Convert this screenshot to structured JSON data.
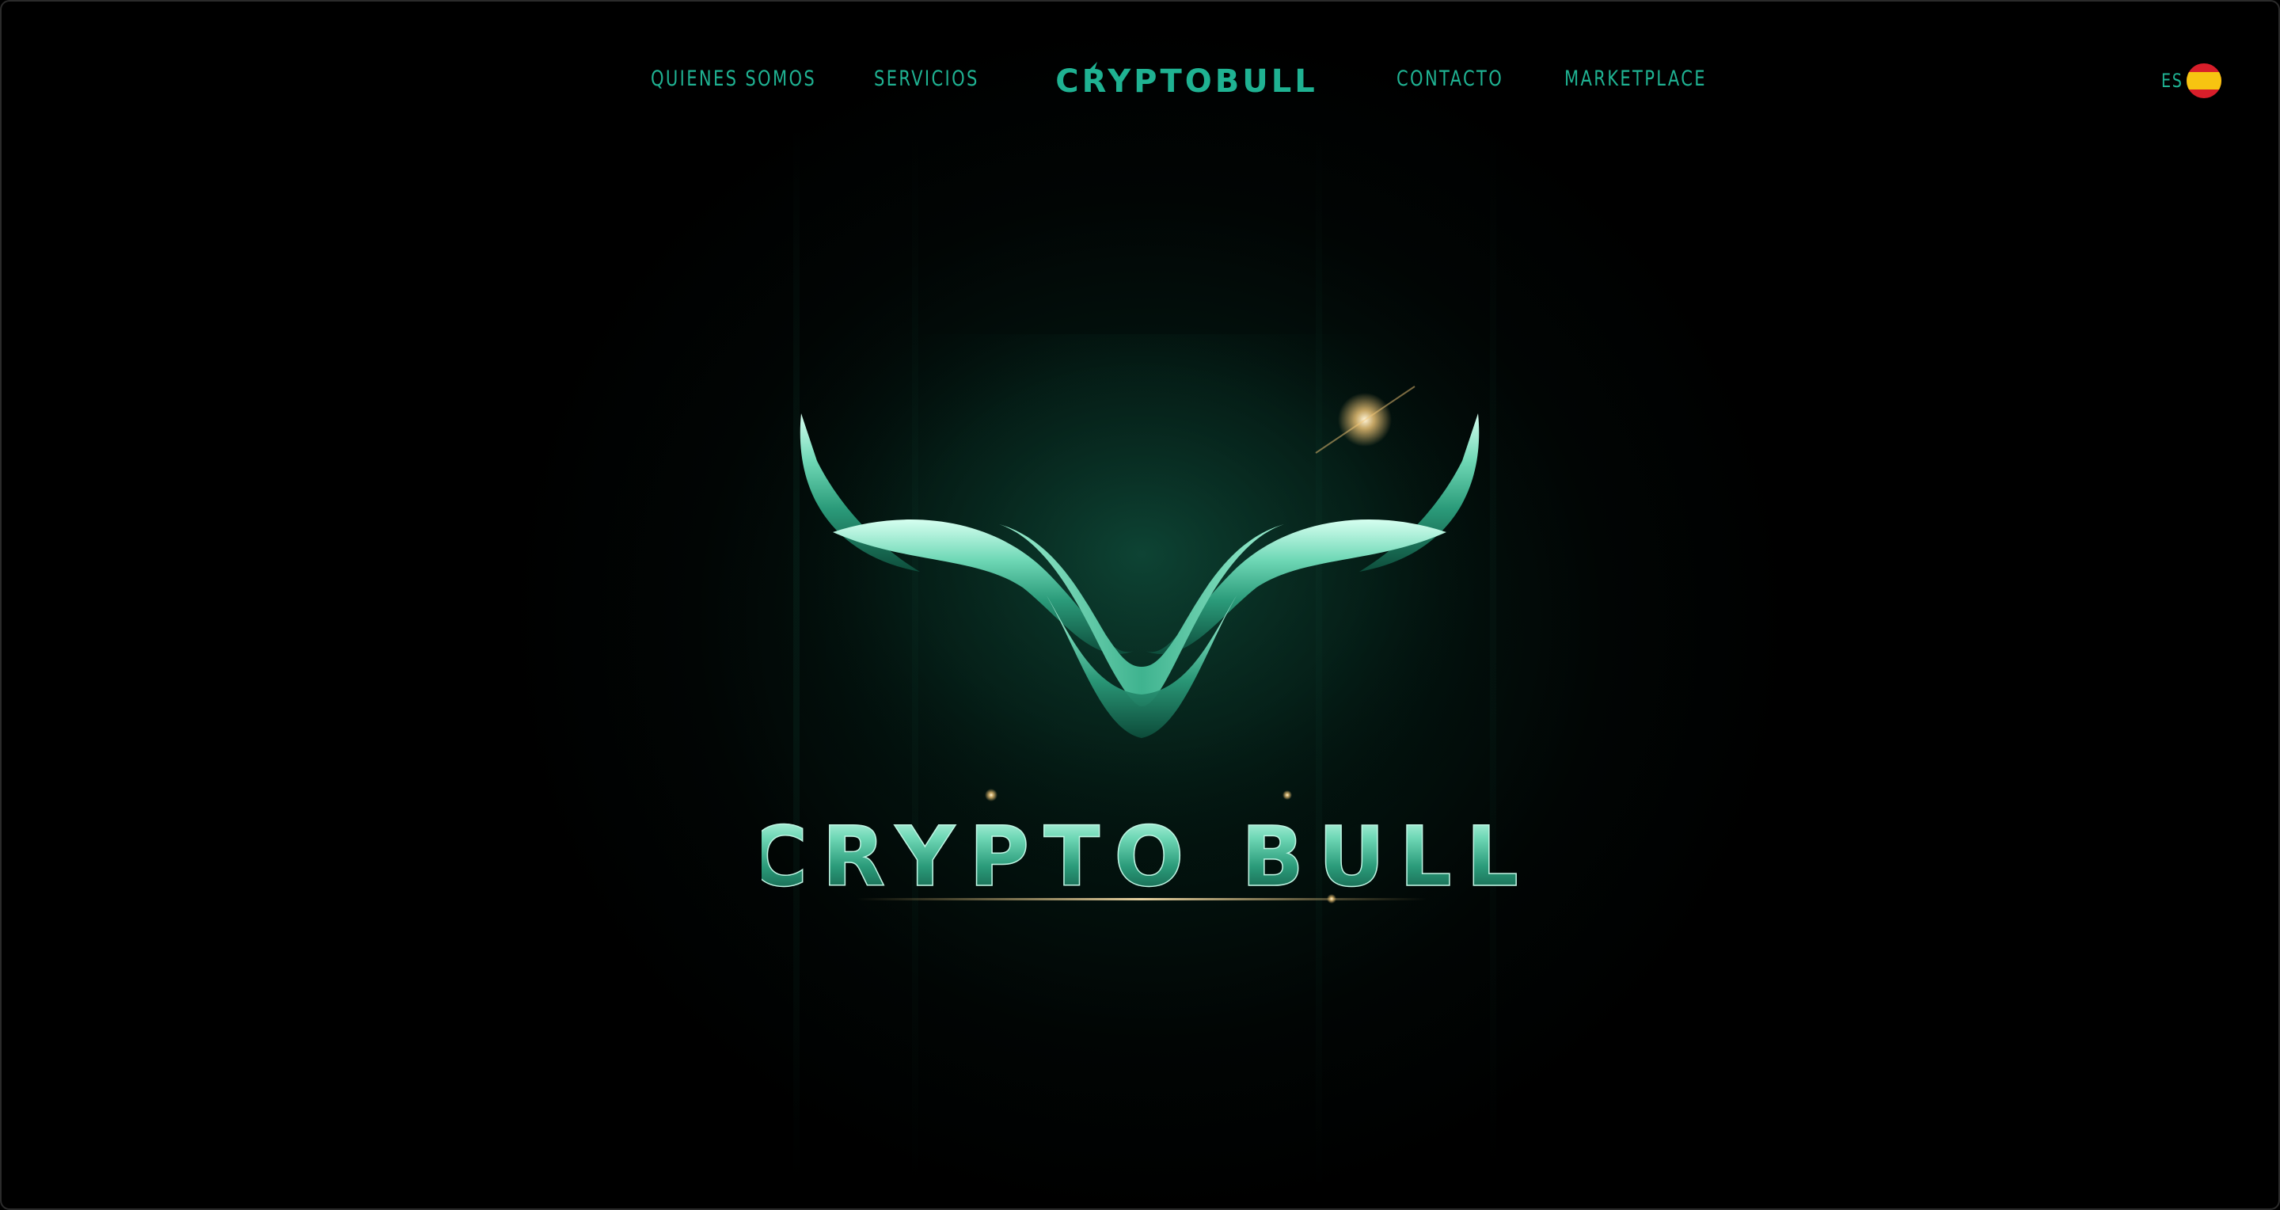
{
  "brand": {
    "logo_text": "CRYPTOBULL",
    "hero_logo_text": "CRYPTO BULL"
  },
  "nav": {
    "items": [
      {
        "label": "QUIENES SOMOS"
      },
      {
        "label": "SERVICIOS"
      },
      {
        "label": "CONTACTO"
      },
      {
        "label": "MARKETPLACE"
      }
    ]
  },
  "language": {
    "code": "ES",
    "flag_icon": "spain-flag-icon"
  },
  "colors": {
    "accent": "#1fb292",
    "background": "#000000",
    "glow": "#0b3b2d",
    "chrome_light": "#bff5e3",
    "chrome_mid": "#4fc7a2",
    "chrome_dark": "#0f5f49",
    "flare": "#f3c878"
  }
}
